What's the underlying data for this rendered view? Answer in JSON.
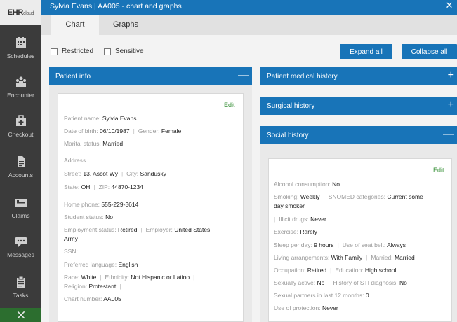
{
  "window": {
    "title": "Sylvia Evans | AA005 - chart and graphs",
    "close_glyph": "✕"
  },
  "sidebar": {
    "logo_main": "EHR",
    "logo_small": "cloud",
    "items": [
      {
        "label": "Schedules",
        "icon": "calendar-icon"
      },
      {
        "label": "Encounter",
        "icon": "people-icon"
      },
      {
        "label": "Checkout",
        "icon": "medical-bag-icon"
      },
      {
        "label": "Accounts",
        "icon": "document-icon"
      },
      {
        "label": "Claims",
        "icon": "claims-icon"
      },
      {
        "label": "Messages",
        "icon": "chat-icon"
      },
      {
        "label": "Tasks",
        "icon": "clipboard-icon"
      }
    ]
  },
  "tabs": [
    {
      "label": "Chart",
      "active": true
    },
    {
      "label": "Graphs",
      "active": false
    }
  ],
  "filters": {
    "restricted": "Restricted",
    "sensitive": "Sensitive"
  },
  "buttons": {
    "expand_all": "Expand all",
    "collapse_all": "Collapse all"
  },
  "panels": {
    "patient_info": {
      "title": "Patient info",
      "ctrl": "—"
    },
    "medical_history": {
      "title": "Patient medical history",
      "ctrl": "+"
    },
    "surgical_history": {
      "title": "Surgical history",
      "ctrl": "+"
    },
    "social_history": {
      "title": "Social history",
      "ctrl": "—"
    }
  },
  "patient_info": {
    "edit": "Edit",
    "name_label": "Patient name:",
    "name": "Sylvia Evans",
    "dob_label": "Date of birth:",
    "dob": "06/10/1987",
    "gender_label": "Gender:",
    "gender": "Female",
    "marital_label": "Marital status:",
    "marital": "Married",
    "address_label": "Address",
    "street_label": "Street:",
    "street": "13, Ascot Wy",
    "city_label": "City:",
    "city": "Sandusky",
    "state_label": "State:",
    "state": "OH",
    "zip_label": "ZIP:",
    "zip": "44870-1234",
    "phone_label": "Home phone:",
    "phone": "555-229-3614",
    "student_label": "Student status:",
    "student": "No",
    "employment_label": "Employment status:",
    "employment": "Retired",
    "employer_label": "Employer:",
    "employer_1": "United States",
    "employer_2": "Army",
    "ssn_label": "SSN:",
    "language_label": "Preferred language:",
    "language": "English",
    "race_label": "Race:",
    "race": "White",
    "ethnicity_label": "Ethnicity:",
    "ethnicity": "Not Hispanic or Latino",
    "religion_label": "Religion:",
    "religion": "Protestant",
    "chart_label": "Chart number:",
    "chart": "AA005"
  },
  "social_history": {
    "edit": "Edit",
    "alcohol_label": "Alcohol consumption:",
    "alcohol": "No",
    "smoking_label": "Smoking:",
    "smoking": "Weekly",
    "snomed_label": "SNOMED categories:",
    "snomed_1": "Current some",
    "snomed_2": "day smoker",
    "drugs_label": "Illicit drugs:",
    "drugs": "Never",
    "exercise_label": "Exercise:",
    "exercise": "Rarely",
    "sleep_label": "Sleep per day:",
    "sleep": "9 hours",
    "seatbelt_label": "Use of seat belt:",
    "seatbelt": "Always",
    "living_label": "Living arrangements:",
    "living": "With Family",
    "married_label": "Married:",
    "married": "Married",
    "occupation_label": "Occupation:",
    "occupation": "Retired",
    "education_label": "Education:",
    "education": "High school",
    "sexually_label": "Sexually active:",
    "sexually": "No",
    "sti_label": "History of STI diagnosis:",
    "sti": "No",
    "partners_label": "Sexual partners in last 12 months:",
    "partners": "0",
    "protection_label": "Use of protection:",
    "protection": "Never"
  },
  "colors": {
    "primary": "#1874b8",
    "sidebar": "#3b3b3b",
    "edit_green": "#2e8b2e"
  }
}
